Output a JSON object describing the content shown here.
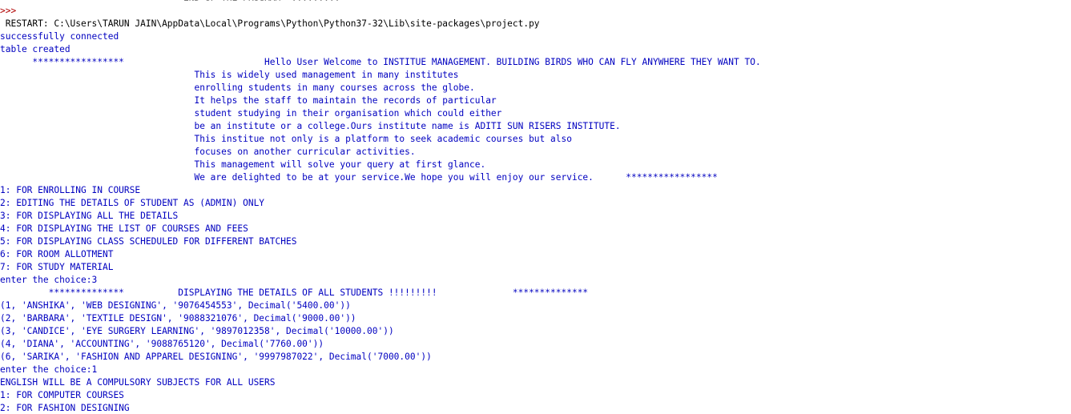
{
  "shell": {
    "lines": [
      {
        "text": "                                  END OF THE PROGRAM  .........",
        "kind": "faint"
      },
      {
        "text": ">>> ",
        "kind": "prompt"
      },
      {
        "text": " RESTART: C:\\Users\\TARUN JAIN\\AppData\\Local\\Programs\\Python\\Python37-32\\Lib\\site-packages\\project.py",
        "kind": "console"
      },
      {
        "text": "successfully connected",
        "kind": "stdout"
      },
      {
        "text": "table created",
        "kind": "stdout"
      },
      {
        "text": "      *****************                          Hello User Welcome to INSTITUE MANAGEMENT. BUILDING BIRDS WHO CAN FLY ANYWHERE THEY WANT TO.",
        "kind": "stdout"
      },
      {
        "text": "                                    This is widely used management in many institutes",
        "kind": "stdout"
      },
      {
        "text": "                                    enrolling students in many courses across the globe.",
        "kind": "stdout"
      },
      {
        "text": "                                    It helps the staff to maintain the records of particular",
        "kind": "stdout"
      },
      {
        "text": "                                    student studying in their organisation which could either",
        "kind": "stdout"
      },
      {
        "text": "                                    be an institute or a college.Ours institute name is ADITI SUN RISERS INSTITUTE.",
        "kind": "stdout"
      },
      {
        "text": "                                    This institue not only is a platform to seek academic courses but also",
        "kind": "stdout"
      },
      {
        "text": "                                    focuses on another curricular activities.",
        "kind": "stdout"
      },
      {
        "text": "                                    This management will solve your query at first glance.",
        "kind": "stdout"
      },
      {
        "text": "                                    We are delighted to be at your service.We hope you will enjoy our service.      *****************",
        "kind": "stdout"
      },
      {
        "text": "1: FOR ENROLLING IN COURSE",
        "kind": "stdout"
      },
      {
        "text": "2: EDITING THE DETAILS OF STUDENT AS (ADMIN) ONLY",
        "kind": "stdout"
      },
      {
        "text": "3: FOR DISPLAYING ALL THE DETAILS",
        "kind": "stdout"
      },
      {
        "text": "4: FOR DISPLAYING THE LIST OF COURSES AND FEES",
        "kind": "stdout"
      },
      {
        "text": "5: FOR DISPLAYING CLASS SCHEDULED FOR DIFFERENT BATCHES",
        "kind": "stdout"
      },
      {
        "text": "6: FOR ROOM ALLOTMENT",
        "kind": "stdout"
      },
      {
        "text": "7: FOR STUDY MATERIAL",
        "kind": "stdout"
      },
      {
        "text": "enter the choice:3",
        "kind": "stdout"
      },
      {
        "text": "         **************          DISPLAYING THE DETAILS OF ALL STUDENTS !!!!!!!!!              **************",
        "kind": "stdout"
      },
      {
        "text": "(1, 'ANSHIKA', 'WEB DESIGNING', '9076454553', Decimal('5400.00'))",
        "kind": "stdout"
      },
      {
        "text": "(2, 'BARBARA', 'TEXTILE DESIGN', '9088321076', Decimal('9000.00'))",
        "kind": "stdout"
      },
      {
        "text": "(3, 'CANDICE', 'EYE SURGERY LEARNING', '9897012358', Decimal('10000.00'))",
        "kind": "stdout"
      },
      {
        "text": "(4, 'DIANA', 'ACCOUNTING', '9088765120', Decimal('7760.00'))",
        "kind": "stdout"
      },
      {
        "text": "(6, 'SARIKA', 'FASHION AND APPAREL DESIGNING', '9997987022', Decimal('7000.00'))",
        "kind": "stdout"
      },
      {
        "text": "enter the choice:1",
        "kind": "stdout"
      },
      {
        "text": "ENGLISH WILL BE A COMPULSORY SUBJECTS FOR ALL USERS",
        "kind": "stdout"
      },
      {
        "text": "1: FOR COMPUTER COURSES",
        "kind": "stdout"
      },
      {
        "text": "2: FOR FASHION DESIGNING",
        "kind": "stdout"
      }
    ]
  }
}
